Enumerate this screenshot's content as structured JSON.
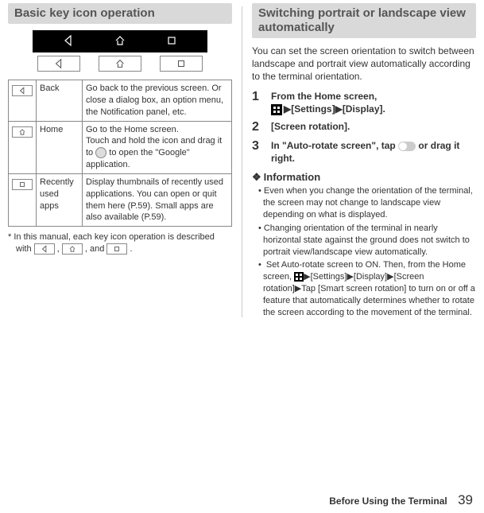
{
  "left": {
    "header": "Basic key icon operation",
    "table": [
      {
        "icon": "back-icon",
        "name": "Back",
        "desc": "Go back to the previous screen. Or close a dialog box, an option menu, the Notification panel, etc."
      },
      {
        "icon": "home-icon",
        "name": "Home",
        "desc_pre": "Go to the Home screen.\nTouch and hold the icon and drag it to ",
        "desc_post": " to open the \"Google\" application."
      },
      {
        "icon": "recent-icon",
        "name": "Recently used apps",
        "desc": "Display thumbnails of recently used applications. You can open or quit them here (P.59). Small apps are also available (P.59)."
      }
    ],
    "footnote_pre": "* In this manual, each key icon operation is described with ",
    "footnote_mid1": ", ",
    "footnote_mid2": ", and ",
    "footnote_post": "."
  },
  "right": {
    "header": "Switching portrait or landscape view automatically",
    "intro": "You can set the screen orientation to switch between landscape and portrait view automatically according to the terminal orientation.",
    "steps": {
      "s1_pre": "From the Home screen, ",
      "s1_settings": "[Settings]",
      "s1_display": "[Display].",
      "s2": "[Screen rotation].",
      "s3_pre": "In \"Auto-rotate screen\", tap ",
      "s3_post": " or drag it right."
    },
    "info_header": "Information",
    "info": [
      "Even when you change the orientation of the terminal, the screen may not change to landscape view depending on what is displayed.",
      "Changing orientation of the terminal in nearly horizontal state against the ground does not switch to portrait view/landscape view automatically.",
      {
        "pre": "Set Auto-rotate screen to ON. Then, from the Home screen, ",
        "seq": "[Settings]▶[Display]▶[Screen rotation]▶",
        "post": "Tap [Smart screen rotation] to turn on or off a feature that automatically determines whether to rotate the screen according to the movement of the terminal."
      }
    ]
  },
  "footer": {
    "section": "Before Using the Terminal",
    "page": "39"
  }
}
